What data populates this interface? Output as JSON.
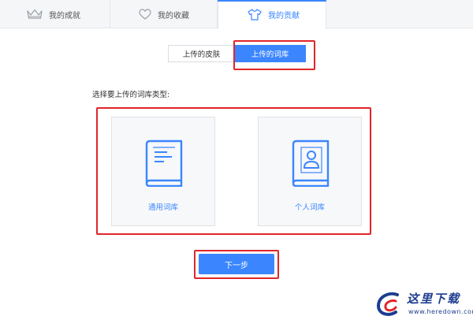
{
  "top_tabs": {
    "achievements": "我的成就",
    "favorites": "我的收藏",
    "contributions": "我的贡献"
  },
  "sub_tabs": {
    "upload_skin": "上传的皮肤",
    "upload_dict": "上传的词库",
    "active": "upload_dict"
  },
  "prompt": "选择要上传的词库类型:",
  "cards": [
    {
      "label": "通用词库",
      "icon": "book-list-icon"
    },
    {
      "label": "个人词库",
      "icon": "book-person-icon"
    }
  ],
  "next_button": "下一步",
  "watermark": {
    "brand": "这里下载",
    "url": "www.heredown.com"
  },
  "colors": {
    "accent": "#3b86ff",
    "highlight_box": "#e0252a",
    "tab_bar": "#f5f6f8"
  }
}
